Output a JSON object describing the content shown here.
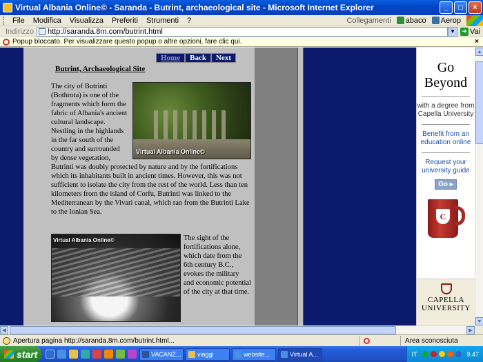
{
  "window": {
    "title": "Virtual Albania Online© - Saranda - Butrint, archaeological site - Microsoft Internet Explorer",
    "minimize": "_",
    "maximize": "□",
    "close": "×"
  },
  "menu": {
    "items": [
      "File",
      "Modifica",
      "Visualizza",
      "Preferiti",
      "Strumenti",
      "?"
    ],
    "links_label": "Collegamenti",
    "links": [
      "abaco",
      "Aerop"
    ]
  },
  "address": {
    "label": "Indirizzo",
    "url": "http://saranda.8m.com/butrint.html",
    "go": "Vai"
  },
  "infobar": {
    "message": "Popup bloccato. Per visualizzare questo popup o altre opzioni, fare clic qui."
  },
  "page": {
    "nav": [
      "Home",
      "Back",
      "Next"
    ],
    "heading": "Butrint, Archaeological Site",
    "paragraph1": "The city of Butrinti (Bothrota) is one of the fragments which form the fabric of Albania's ancient cultural landscape. Nestling in the highlands in the far south of the country and surrounded by dense vegetation, Butrinti was doubly protected by nature and by the fortifications which its inhabitants built in ancient times. However, this was not sufficient to isolate the city from the rest of the world. Less than ten kilometers from the island of Corfu, Butrinti was linked to the Mediterranean by the Vivari canal, which ran from the Butrinti Lake to the Ionian Sea.",
    "paragraph2": "The sight of the fortifications alone, which date from the 6th century B.C., evokes the military and economic potential of the city at that time.",
    "photo_caption": "Virtual Albania Online©"
  },
  "ad": {
    "headline": "Go Beyond",
    "sub": "with a degree from Capella University",
    "link1": "Benefit from an education online",
    "link2": "Request your university guide",
    "go": "Go",
    "brand": "CAPELLA UNIVERSITY"
  },
  "status": {
    "text": "Apertura pagina http://saranda.8m.com/butrint.html...",
    "zone": "Area sconosciuta"
  },
  "taskbar": {
    "start": "start",
    "tasks": [
      "VACANZ...",
      "viaggi",
      "website...",
      "Virtual A..."
    ],
    "lang": "IT",
    "time": "9.47"
  }
}
